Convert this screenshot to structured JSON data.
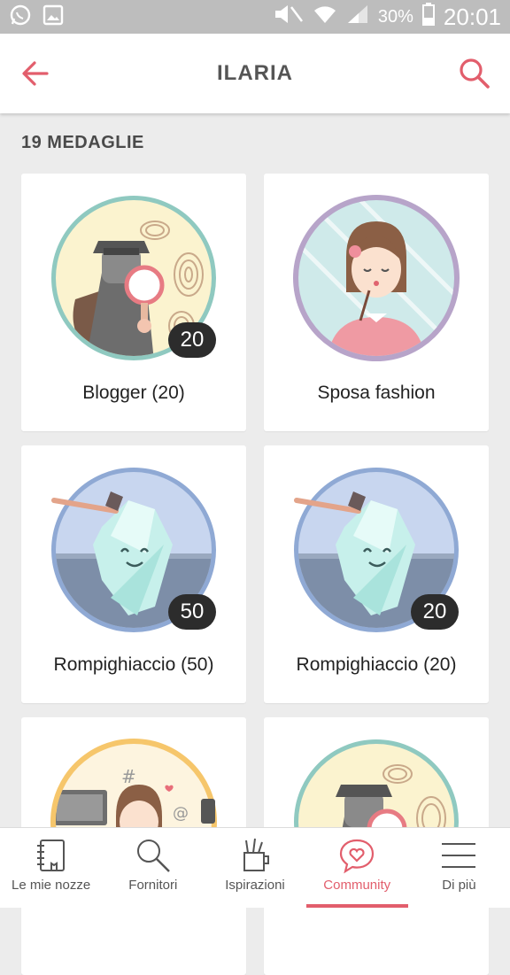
{
  "status_bar": {
    "battery": "30%",
    "time": "20:01",
    "icons": [
      "whatsapp-icon",
      "gallery-icon",
      "mute-icon",
      "wifi-icon",
      "signal-icon",
      "battery-icon"
    ]
  },
  "header": {
    "title": "ILARIA",
    "back_icon": "arrow-left-icon",
    "search_icon": "search-icon"
  },
  "section": {
    "label": "19 MEDAGLIE"
  },
  "medals": [
    {
      "label": "Blogger (20)",
      "count": "20",
      "art": "detective"
    },
    {
      "label": "Sposa fashion",
      "count": "",
      "art": "bride"
    },
    {
      "label": "Rompighiaccio (50)",
      "count": "50",
      "art": "iceberg"
    },
    {
      "label": "Rompighiaccio (20)",
      "count": "20",
      "art": "iceberg"
    },
    {
      "label": "",
      "count": "",
      "art": "tech-girl"
    },
    {
      "label": "",
      "count": "",
      "art": "detective"
    }
  ],
  "bottom_nav": [
    {
      "label": "Le mie nozze",
      "icon": "notebook-icon",
      "active": false
    },
    {
      "label": "Fornitori",
      "icon": "search-icon",
      "active": false
    },
    {
      "label": "Ispirazioni",
      "icon": "pencil-cup-icon",
      "active": false
    },
    {
      "label": "Community",
      "icon": "heart-chat-icon",
      "active": true
    },
    {
      "label": "Di più",
      "icon": "menu-icon",
      "active": false
    }
  ],
  "colors": {
    "accent": "#e25e6c",
    "background": "#ececec",
    "status_bar": "#bdbdbd"
  }
}
